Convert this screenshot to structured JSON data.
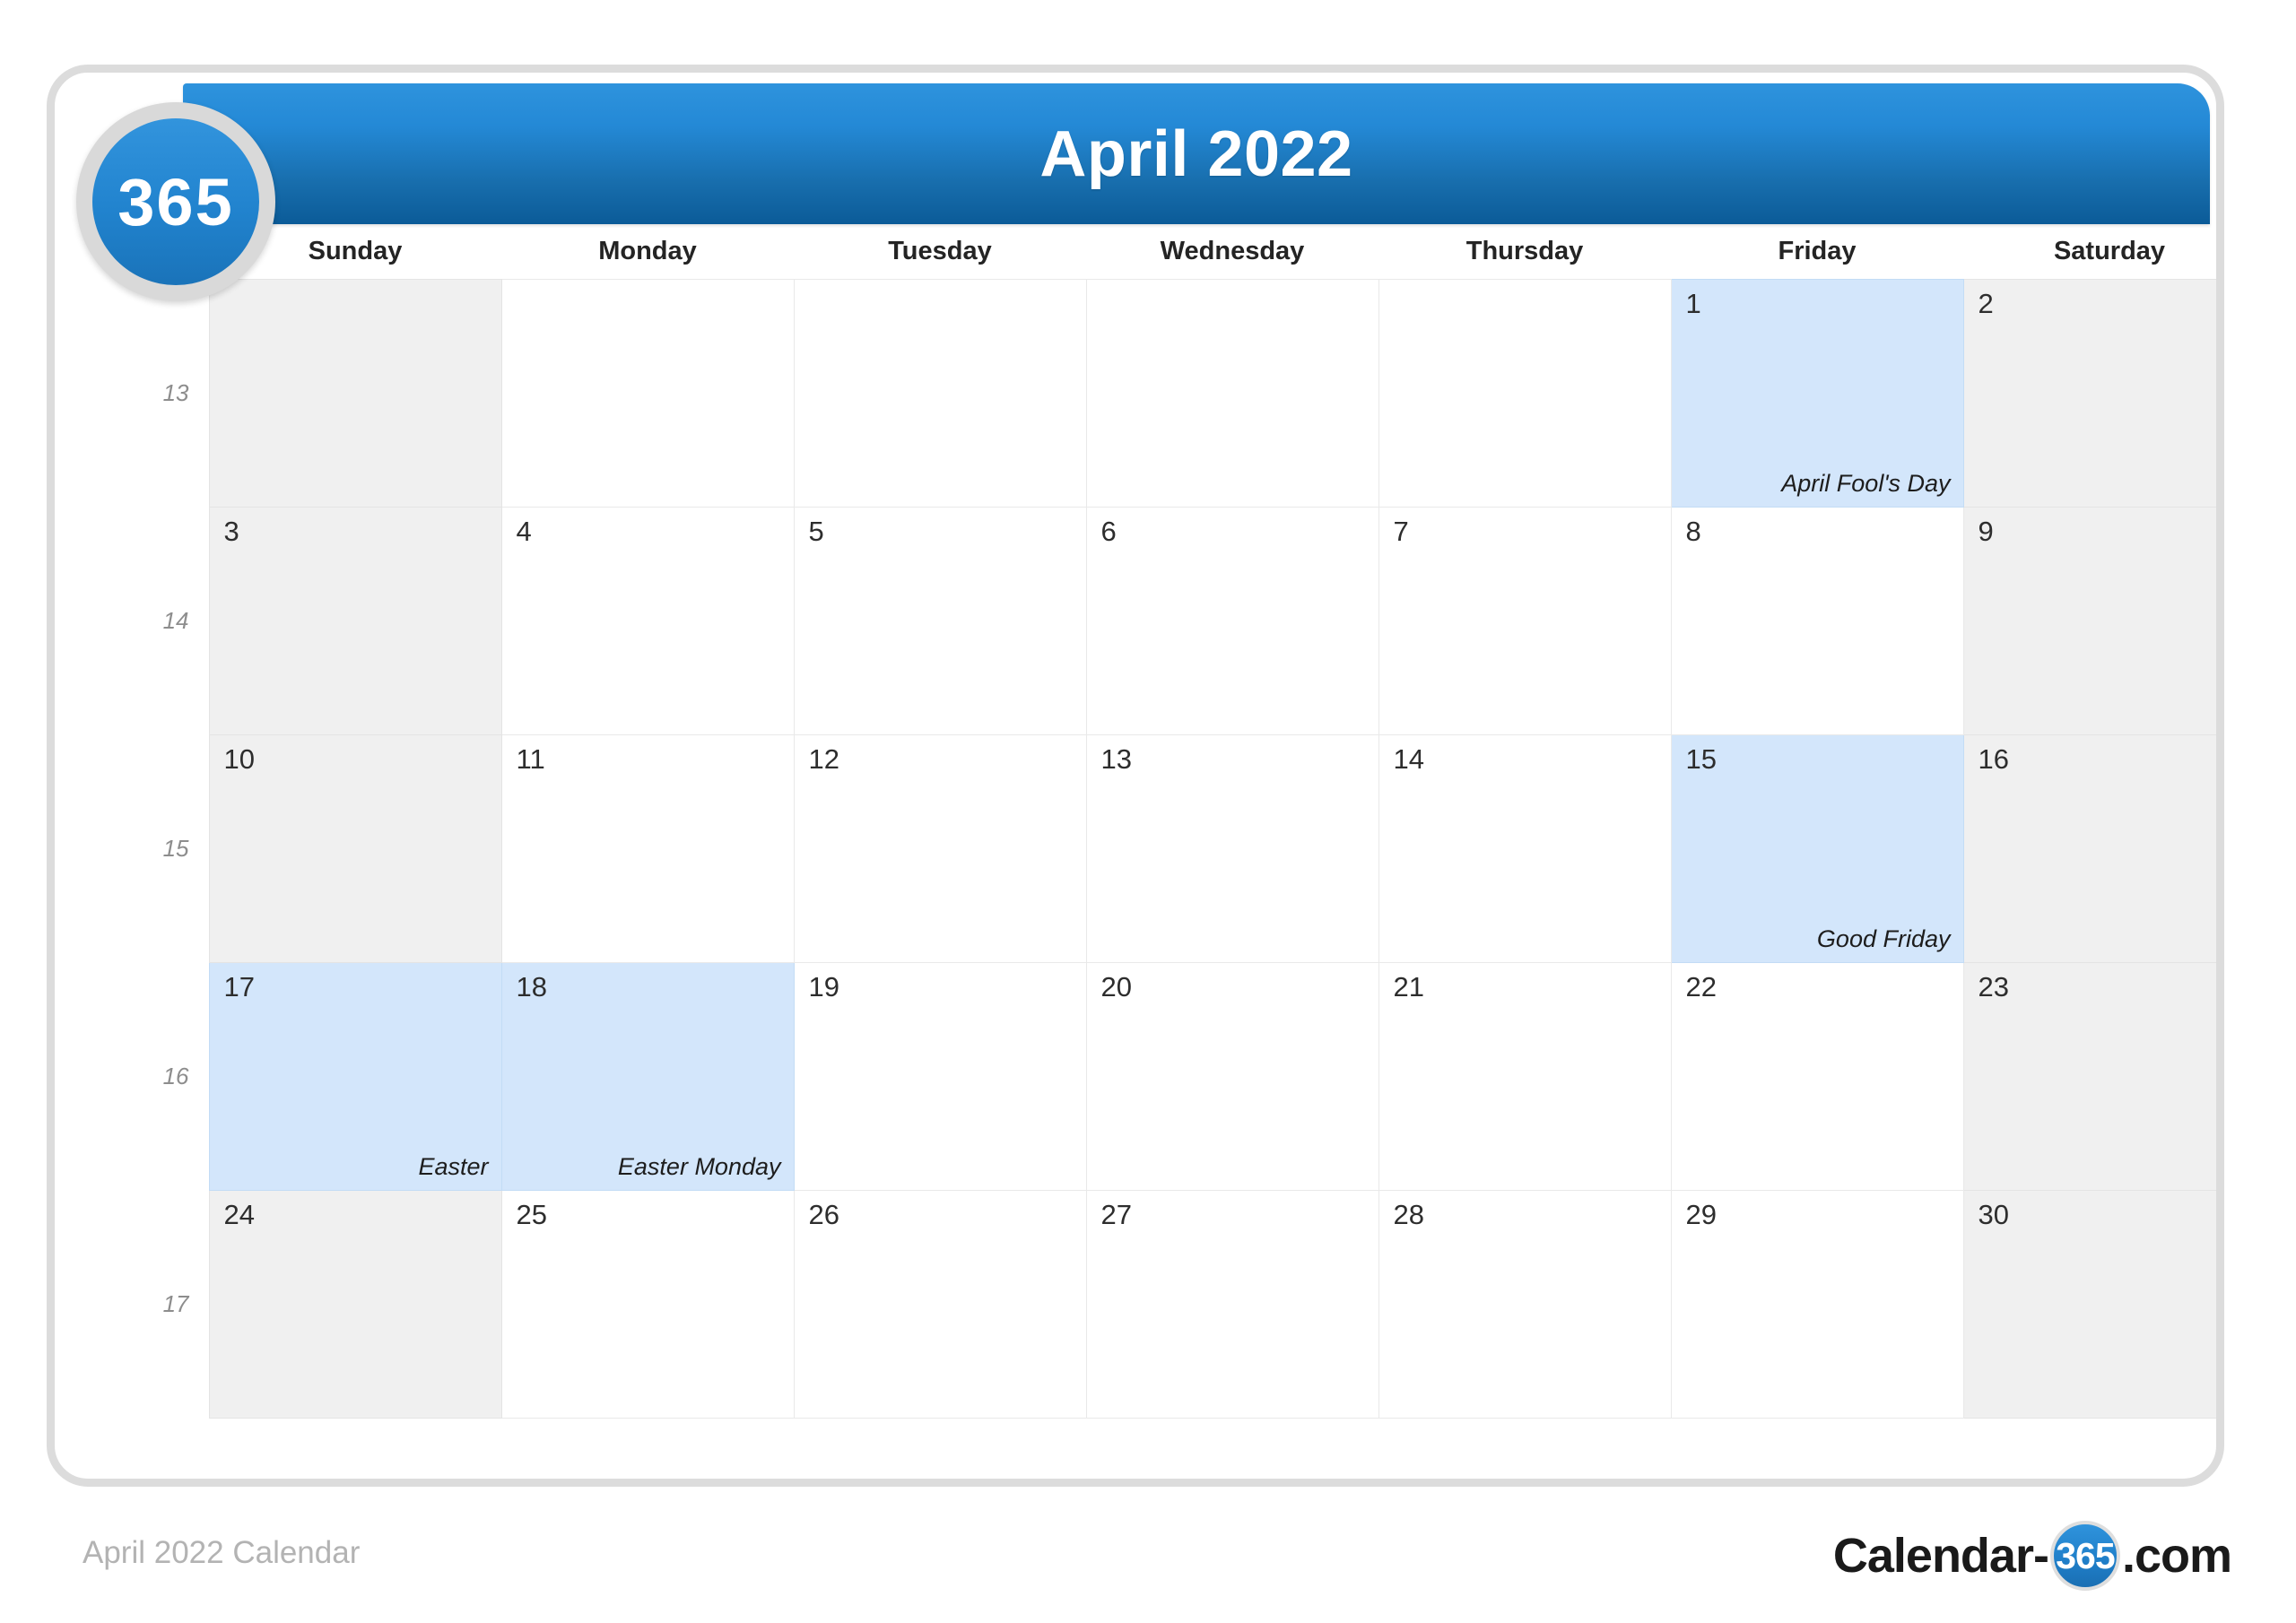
{
  "logo": {
    "badge_text": "365"
  },
  "header": {
    "title": "April 2022"
  },
  "weekday_header_label": "",
  "weekdays": [
    "Sunday",
    "Monday",
    "Tuesday",
    "Wednesday",
    "Thursday",
    "Friday",
    "Saturday"
  ],
  "weeks": [
    {
      "week_number": "13",
      "days": [
        {
          "num": "",
          "holiday": "",
          "weekend": true,
          "highlight": false
        },
        {
          "num": "",
          "holiday": "",
          "weekend": false,
          "highlight": false
        },
        {
          "num": "",
          "holiday": "",
          "weekend": false,
          "highlight": false
        },
        {
          "num": "",
          "holiday": "",
          "weekend": false,
          "highlight": false
        },
        {
          "num": "",
          "holiday": "",
          "weekend": false,
          "highlight": false
        },
        {
          "num": "1",
          "holiday": "April Fool's Day",
          "weekend": false,
          "highlight": true
        },
        {
          "num": "2",
          "holiday": "",
          "weekend": true,
          "highlight": false
        }
      ]
    },
    {
      "week_number": "14",
      "days": [
        {
          "num": "3",
          "holiday": "",
          "weekend": true,
          "highlight": false
        },
        {
          "num": "4",
          "holiday": "",
          "weekend": false,
          "highlight": false
        },
        {
          "num": "5",
          "holiday": "",
          "weekend": false,
          "highlight": false
        },
        {
          "num": "6",
          "holiday": "",
          "weekend": false,
          "highlight": false
        },
        {
          "num": "7",
          "holiday": "",
          "weekend": false,
          "highlight": false
        },
        {
          "num": "8",
          "holiday": "",
          "weekend": false,
          "highlight": false
        },
        {
          "num": "9",
          "holiday": "",
          "weekend": true,
          "highlight": false
        }
      ]
    },
    {
      "week_number": "15",
      "days": [
        {
          "num": "10",
          "holiday": "",
          "weekend": true,
          "highlight": false
        },
        {
          "num": "11",
          "holiday": "",
          "weekend": false,
          "highlight": false
        },
        {
          "num": "12",
          "holiday": "",
          "weekend": false,
          "highlight": false
        },
        {
          "num": "13",
          "holiday": "",
          "weekend": false,
          "highlight": false
        },
        {
          "num": "14",
          "holiday": "",
          "weekend": false,
          "highlight": false
        },
        {
          "num": "15",
          "holiday": "Good Friday",
          "weekend": false,
          "highlight": true
        },
        {
          "num": "16",
          "holiday": "",
          "weekend": true,
          "highlight": false
        }
      ]
    },
    {
      "week_number": "16",
      "days": [
        {
          "num": "17",
          "holiday": "Easter",
          "weekend": true,
          "highlight": true
        },
        {
          "num": "18",
          "holiday": "Easter Monday",
          "weekend": false,
          "highlight": true
        },
        {
          "num": "19",
          "holiday": "",
          "weekend": false,
          "highlight": false
        },
        {
          "num": "20",
          "holiday": "",
          "weekend": false,
          "highlight": false
        },
        {
          "num": "21",
          "holiday": "",
          "weekend": false,
          "highlight": false
        },
        {
          "num": "22",
          "holiday": "",
          "weekend": false,
          "highlight": false
        },
        {
          "num": "23",
          "holiday": "",
          "weekend": true,
          "highlight": false
        }
      ]
    },
    {
      "week_number": "17",
      "days": [
        {
          "num": "24",
          "holiday": "",
          "weekend": true,
          "highlight": false
        },
        {
          "num": "25",
          "holiday": "",
          "weekend": false,
          "highlight": false
        },
        {
          "num": "26",
          "holiday": "",
          "weekend": false,
          "highlight": false
        },
        {
          "num": "27",
          "holiday": "",
          "weekend": false,
          "highlight": false
        },
        {
          "num": "28",
          "holiday": "",
          "weekend": false,
          "highlight": false
        },
        {
          "num": "29",
          "holiday": "",
          "weekend": false,
          "highlight": false
        },
        {
          "num": "30",
          "holiday": "",
          "weekend": true,
          "highlight": false
        }
      ]
    }
  ],
  "watermark_text": "365",
  "footer": {
    "caption": "April 2022 Calendar",
    "brand_prefix": "Calendar-",
    "brand_badge": "365",
    "brand_suffix": ".com"
  },
  "colors": {
    "header_blue_top": "#2e93dd",
    "header_blue_bottom": "#0b5b98",
    "highlight_blue": "#d3e6fb",
    "weekend_gray": "#f0f0f0",
    "card_border": "#dcdcdc",
    "grid_line": "#e9e9e9"
  }
}
